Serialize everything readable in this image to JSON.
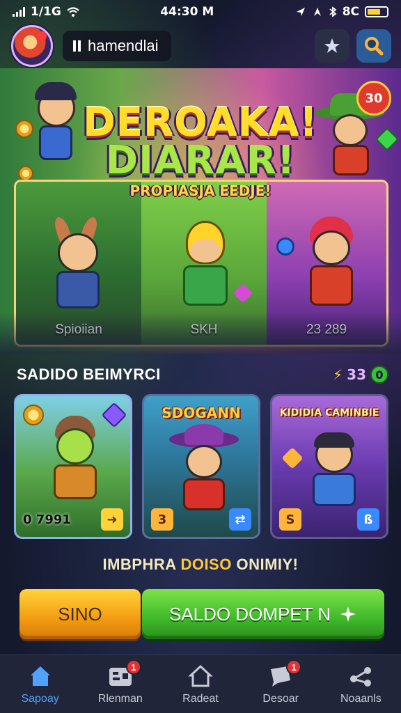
{
  "status_bar": {
    "network": "1/1G",
    "time": "44:30 M",
    "right_text": "8C"
  },
  "header": {
    "username": "hamendlai",
    "user_icon": "pause-icon",
    "action_icons": [
      "star-badge-icon",
      "search-icon"
    ]
  },
  "hero": {
    "score_badge": "30",
    "title_line1": "DEROAKA!",
    "title_line2": "DIARAR!",
    "subtitle": "PROPIASJA EEDJE!",
    "panels": [
      {
        "label": "Spioiian"
      },
      {
        "label": "SKH"
      },
      {
        "label": "23 289"
      }
    ]
  },
  "section": {
    "title": "SADIDO BEIMYRCI",
    "currency_value": "33",
    "currency_badge": "0"
  },
  "cards": [
    {
      "title": "",
      "value": "0 7991",
      "icon_label": ""
    },
    {
      "title": "SDOGANN",
      "value": "",
      "icon_label": "3"
    },
    {
      "title": "KIDIDIA CAMINBIE",
      "value": "",
      "icon_label": "S"
    }
  ],
  "promo": {
    "text_white": "IMBPHRA ",
    "text_highlight": "DOISO",
    "text_end": " ONIMIY!"
  },
  "actions": {
    "primary_label": "SINO",
    "secondary_label": "SALDO DOMPET N"
  },
  "nav": [
    {
      "label": "Sapoay",
      "icon": "home-icon",
      "badge": ""
    },
    {
      "label": "Rlenman",
      "icon": "inventory-icon",
      "badge": "1"
    },
    {
      "label": "Radeat",
      "icon": "house-icon",
      "badge": ""
    },
    {
      "label": "Desoar",
      "icon": "chat-icon",
      "badge": "1"
    },
    {
      "label": "Noaanls",
      "icon": "share-icon",
      "badge": ""
    }
  ],
  "colors": {
    "accent_blue": "#4fa3ff",
    "primary_orange": "#f39b12",
    "secondary_green": "#3fb82a",
    "badge_red": "#e53232"
  }
}
